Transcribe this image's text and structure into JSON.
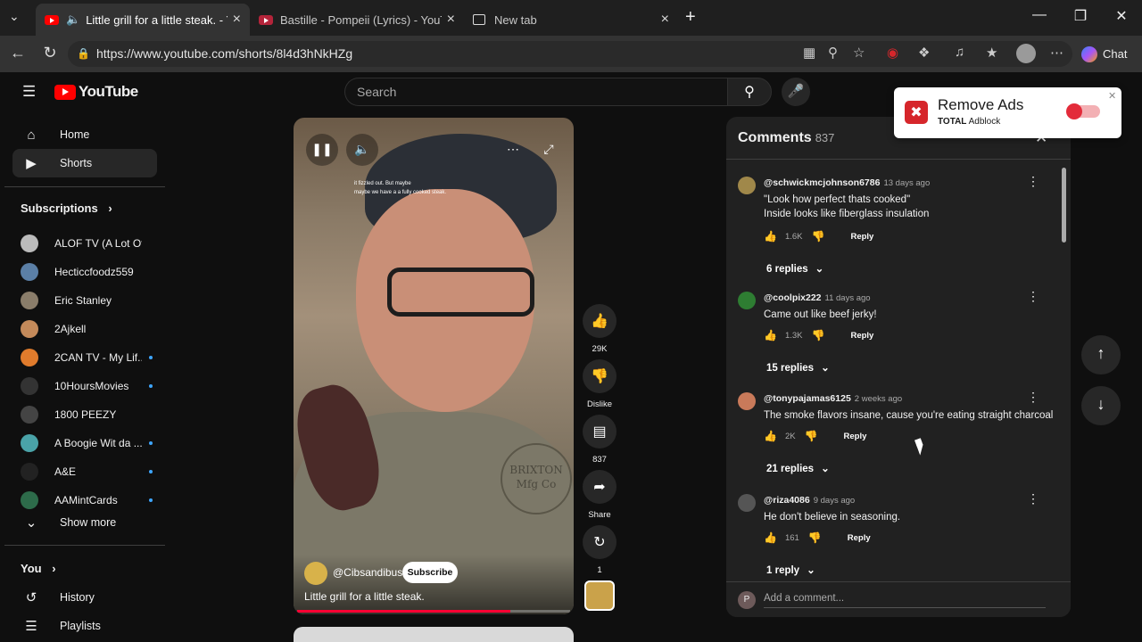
{
  "browser": {
    "tabs": [
      {
        "title": "Little grill for a little steak. - Yo",
        "active": true
      },
      {
        "title": "Bastille - Pompeii (Lyrics) - YouTub",
        "active": false
      },
      {
        "title": "New tab",
        "active": false
      }
    ],
    "url": "https://www.youtube.com/shorts/8l4d3hNkHZg",
    "chat_label": "Chat"
  },
  "masthead": {
    "logo_text": "YouTube",
    "search_placeholder": "Search"
  },
  "sidebar": {
    "main": [
      {
        "label": "Home",
        "icon": "home-icon"
      },
      {
        "label": "Shorts",
        "icon": "shorts-icon",
        "active": true
      }
    ],
    "subscriptions_title": "Subscriptions",
    "subscriptions": [
      {
        "name": "ALOF TV (A Lot Of ...",
        "color": "#bbbbbb",
        "new": false
      },
      {
        "name": "Hecticcfoodz559",
        "color": "#5b7fa6",
        "new": false
      },
      {
        "name": "Eric Stanley",
        "color": "#8a7d6a",
        "new": false
      },
      {
        "name": "2Ajkell",
        "color": "#c48a5a",
        "new": false
      },
      {
        "name": "2CAN TV - My Lif...",
        "color": "#e07b2c",
        "new": true
      },
      {
        "name": "10HoursMovies",
        "color": "#333333",
        "new": true
      },
      {
        "name": "1800 PEEZY",
        "color": "#444444",
        "new": false
      },
      {
        "name": "A Boogie Wit da ...",
        "color": "#4aa3a8",
        "new": true
      },
      {
        "name": "A&E",
        "color": "#222222",
        "new": true
      },
      {
        "name": "AAMintCards",
        "color": "#2d6b4a",
        "new": true
      }
    ],
    "show_more": "Show more",
    "you_title": "You",
    "you_items": [
      {
        "label": "History",
        "icon": "history-icon"
      },
      {
        "label": "Playlists",
        "icon": "playlists-icon"
      }
    ]
  },
  "short": {
    "caption_line1": "it fizzled out. But maybe",
    "caption_line2": "maybe we have a a fully cooked steak.",
    "brand_text_1": "BRIXTON",
    "brand_text_2": "Mfg Co",
    "channel": "@Cibsandibus",
    "subscribe_label": "Subscribe",
    "title": "Little grill for a little steak.",
    "progress": 0.78
  },
  "actions": {
    "likes": "29K",
    "dislike_label": "Dislike",
    "comments": "837",
    "share_label": "Share",
    "remix": "1"
  },
  "comments": {
    "title": "Comments",
    "count": "837",
    "add_placeholder": "Add a comment...",
    "add_avatar_letter": "P",
    "items": [
      {
        "author": "@schwickmcjohnson6786",
        "when": "13 days ago",
        "text": "\"Look how perfect thats cooked\"\nInside looks like fiberglass insulation",
        "likes": "1.6K",
        "replies": "6 replies",
        "avatar_color": "#a0884a"
      },
      {
        "author": "@coolpix222",
        "when": "11 days ago",
        "text": "Came out like beef jerky!",
        "likes": "1.3K",
        "replies": "15 replies",
        "avatar_color": "#2e7d32"
      },
      {
        "author": "@tonypajamas6125",
        "when": "2 weeks ago",
        "text": "The smoke flavors insane, cause you're eating straight charcoal",
        "likes": "2K",
        "replies": "21 replies",
        "avatar_color": "#c97a5a"
      },
      {
        "author": "@riza4086",
        "when": "9 days ago",
        "text": "He don't believe in seasoning.",
        "likes": "161",
        "replies": "1 reply",
        "avatar_color": "#555555"
      }
    ],
    "reply_label": "Reply"
  },
  "adblock": {
    "title": "Remove Ads",
    "brand_bold": "TOTAL",
    "brand_rest": " Adblock"
  },
  "colors": {
    "accent": "#ff0000",
    "progress": "#ff0033",
    "link": "#3ea6ff"
  }
}
